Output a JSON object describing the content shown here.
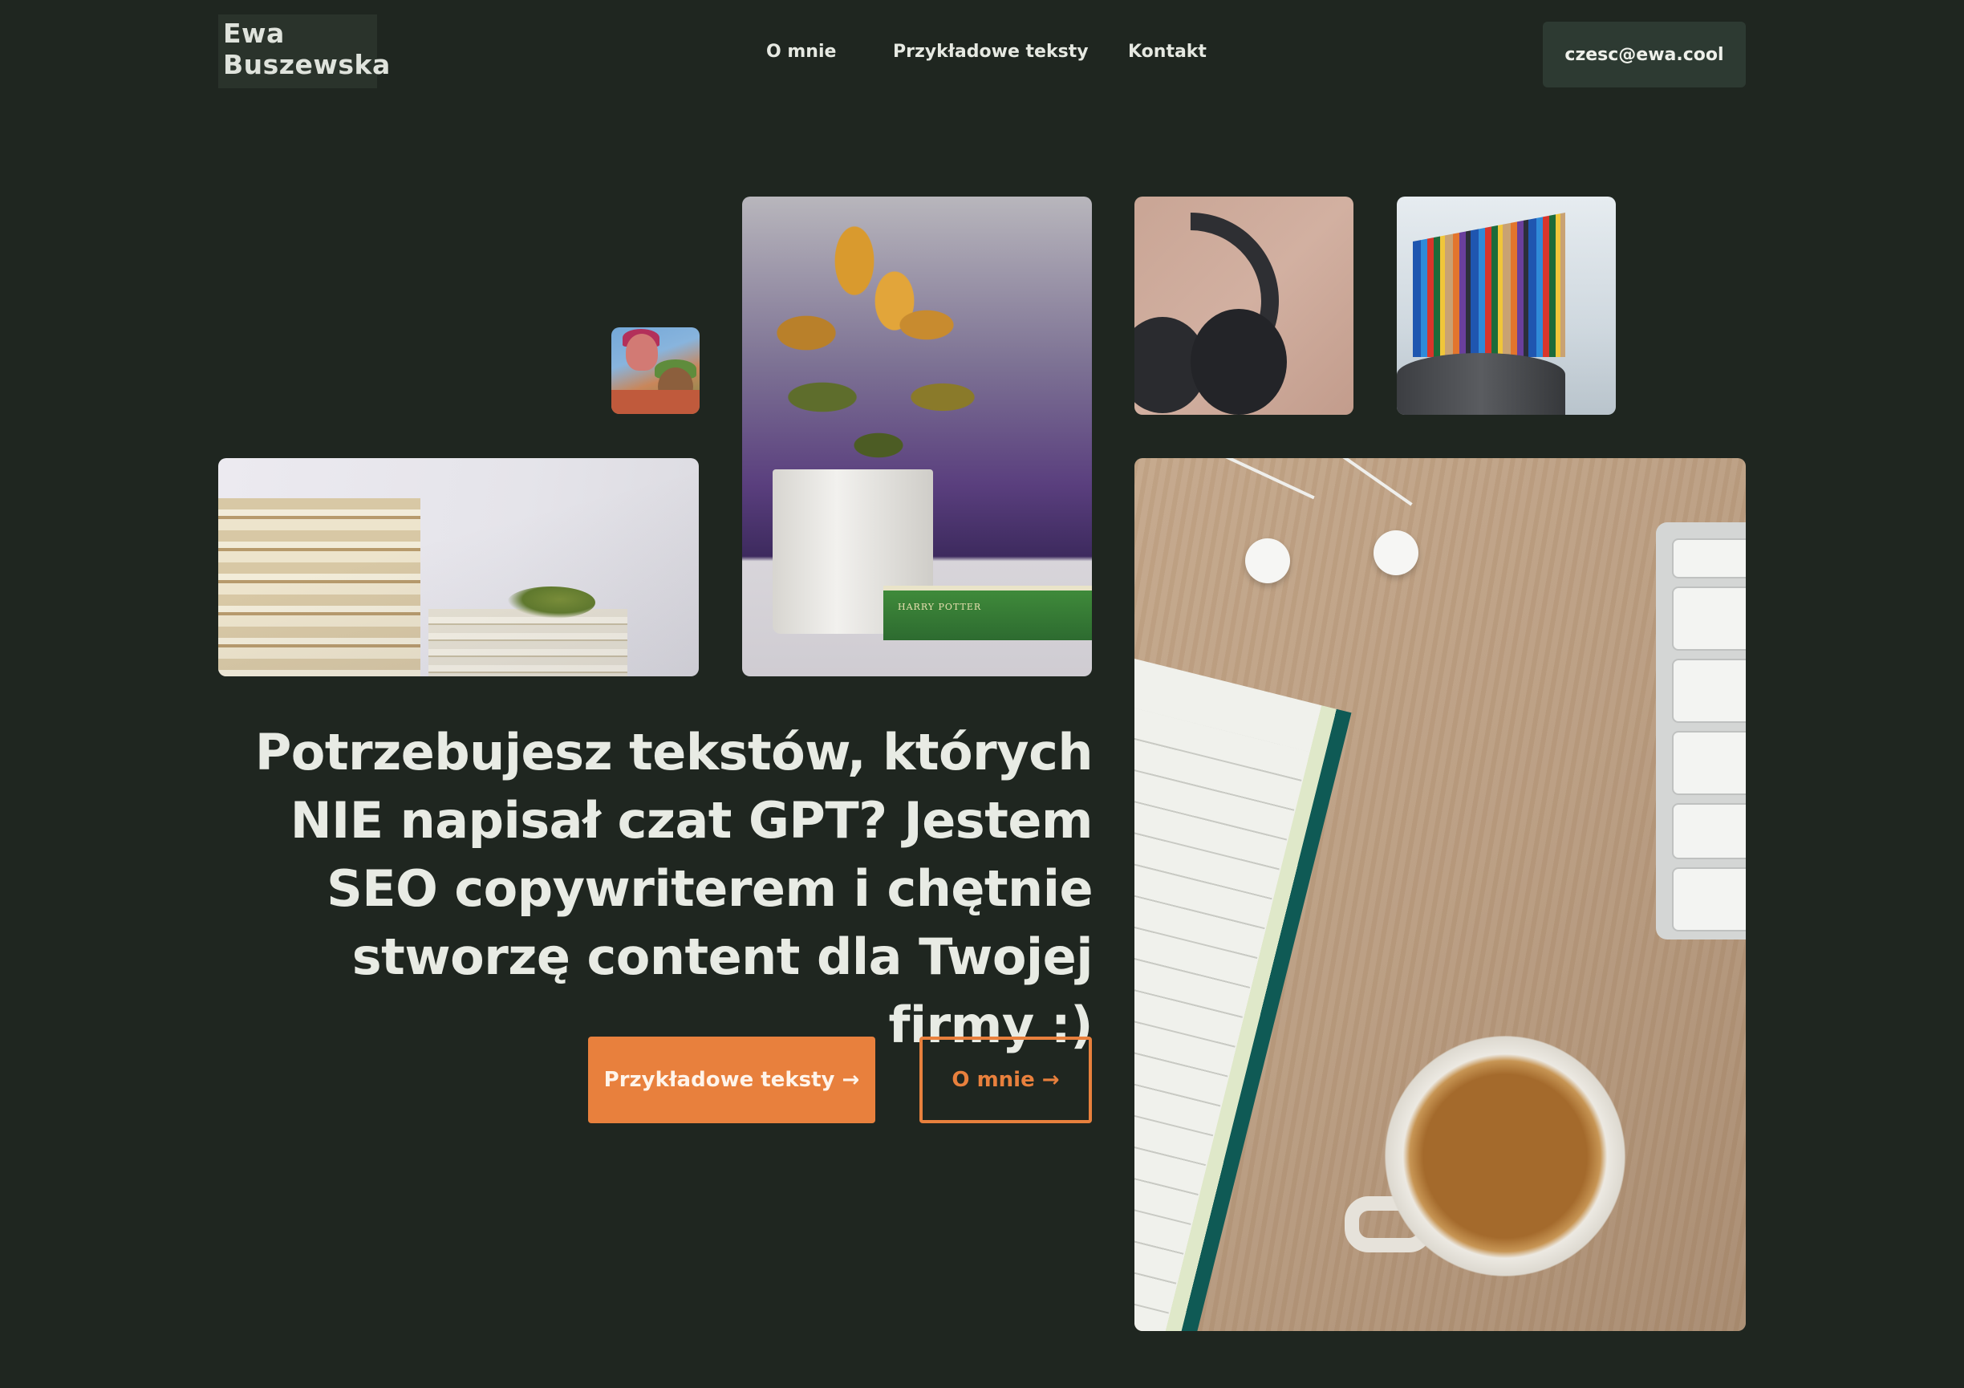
{
  "brand": {
    "line1": "Ewa",
    "line2": "Buszewska"
  },
  "nav": {
    "items": [
      {
        "label": "O mnie"
      },
      {
        "label": "Przykładowe teksty"
      },
      {
        "label": "Kontakt"
      }
    ],
    "email": "czesc@ewa.cool"
  },
  "hero": {
    "headline_lines": [
      "Potrzebujesz tekstów, których",
      "NIE napisał czat GPT? Jestem",
      "SEO copywriterem i chętnie",
      "stworzę content dla Twojej firmy :)"
    ],
    "primary_button": "Przykładowe teksty →",
    "secondary_button": "O mnie →"
  },
  "photos": {
    "book_text": "HARRY POTTER"
  },
  "colors": {
    "background": "#1f2620",
    "accent": "#e8803d",
    "email_button_bg": "#2d3a32",
    "text": "#e8ebe4"
  }
}
